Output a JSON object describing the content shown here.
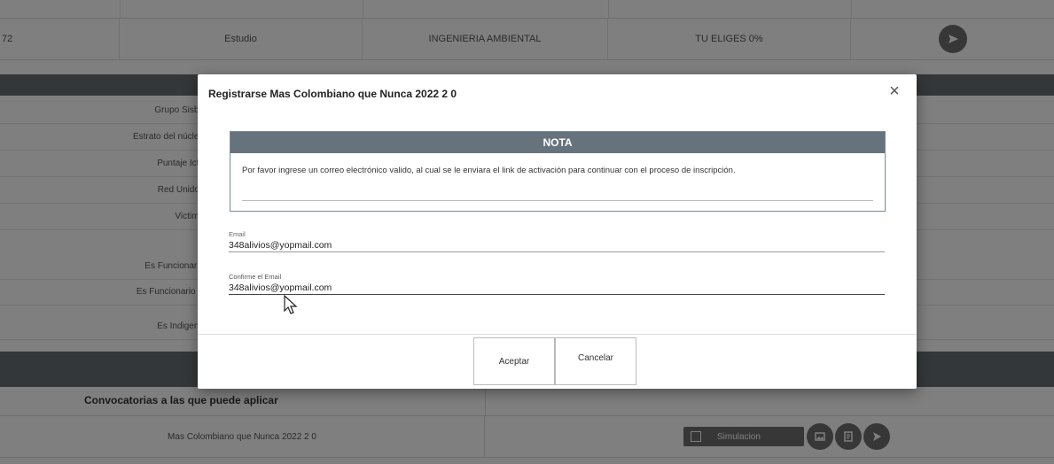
{
  "background": {
    "top_row": {
      "id_fragment": "72",
      "type": "Estudio",
      "program": "INGENIERIA AMBIENTAL",
      "plan": "TU ELIGES 0%"
    },
    "info_labels": [
      "Grupo Sisbe",
      "Estrato del núcleo",
      "Puntaje Icfe",
      "Red Unidos",
      "Victima",
      "Es Funcionario",
      "Es Funcionario P",
      "Es Indigena"
    ],
    "convocatorias_header": "Convocatorias a las que puede aplicar",
    "convocatoria_row": {
      "name": "Mas Colombiano que Nunca 2022 2 0",
      "simulation_label": "Simulacion"
    }
  },
  "modal": {
    "title": "Registrarse Mas Colombiano que Nunca 2022 2 0",
    "close_symbol": "×",
    "note": {
      "heading": "NOTA",
      "text": "Por favor ingrese un correo electrónico valido, al cual se le enviara el link de activación para continuar con el proceso de inscripción."
    },
    "email": {
      "label": "Email",
      "value": "348alivios@yopmail.com"
    },
    "confirm_email": {
      "label": "Confirme el Email",
      "value": "348alivios@yopmail.com"
    },
    "buttons": {
      "accept": "Aceptar",
      "cancel": "Cancelar"
    }
  },
  "icons": {
    "send": "send-icon",
    "close": "close-icon",
    "chart": "chart-icon",
    "image": "image-icon",
    "document": "document-icon",
    "cursor": "mouse-pointer-icon"
  }
}
